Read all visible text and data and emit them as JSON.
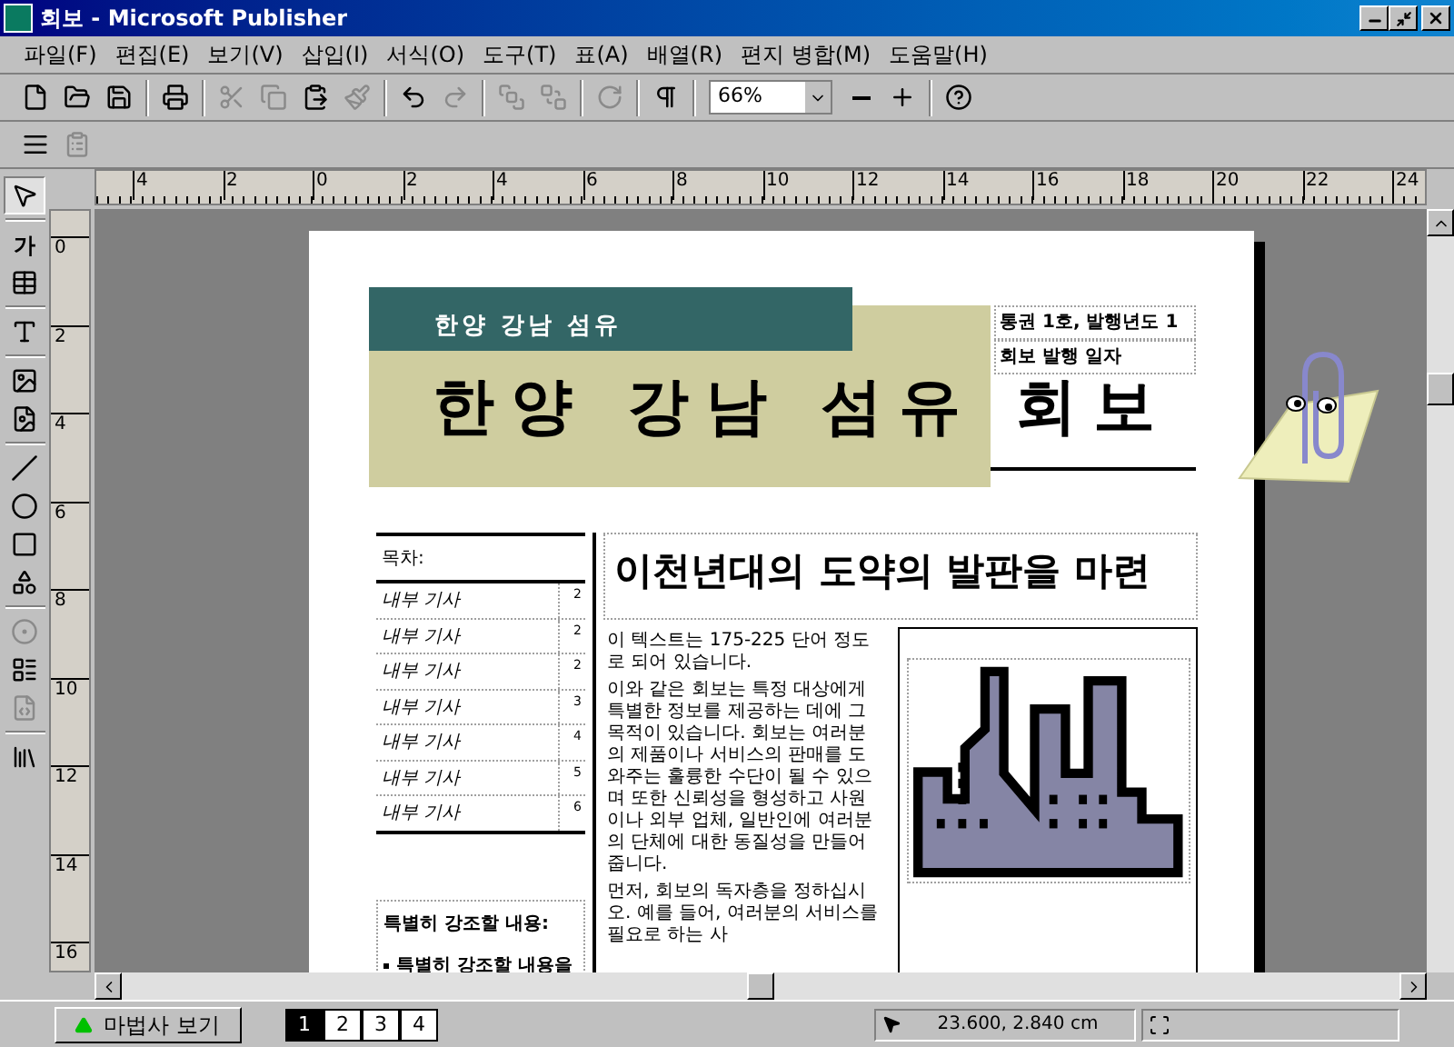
{
  "window": {
    "title": "회보 - Microsoft Publisher"
  },
  "menu": [
    "파일(F)",
    "편집(E)",
    "보기(V)",
    "삽입(I)",
    "서식(O)",
    "도구(T)",
    "표(A)",
    "배열(R)",
    "편지 병합(M)",
    "도움말(H)"
  ],
  "toolbar": [
    {
      "kind": "new",
      "disabled": false
    },
    {
      "kind": "open",
      "disabled": false
    },
    {
      "kind": "save",
      "disabled": false
    },
    {
      "kind": "separator"
    },
    {
      "kind": "print",
      "disabled": false
    },
    {
      "kind": "separator"
    },
    {
      "kind": "cut",
      "disabled": true
    },
    {
      "kind": "copy",
      "disabled": true
    },
    {
      "kind": "paste",
      "disabled": false
    },
    {
      "kind": "painter",
      "disabled": true
    },
    {
      "kind": "separator"
    },
    {
      "kind": "undo",
      "disabled": false
    },
    {
      "kind": "redo",
      "disabled": true
    },
    {
      "kind": "separator"
    },
    {
      "kind": "front",
      "disabled": true
    },
    {
      "kind": "back",
      "disabled": true
    },
    {
      "kind": "separator"
    },
    {
      "kind": "rotate",
      "disabled": true
    },
    {
      "kind": "separator"
    },
    {
      "kind": "pilcrow",
      "disabled": false
    },
    {
      "kind": "separator"
    },
    {
      "kind": "zoom",
      "value": "66%"
    },
    {
      "kind": "zoom-out",
      "disabled": false
    },
    {
      "kind": "zoom-in",
      "disabled": false
    },
    {
      "kind": "separator"
    },
    {
      "kind": "help",
      "disabled": false
    }
  ],
  "format_toolbar": [
    {
      "kind": "lines",
      "disabled": false
    },
    {
      "kind": "properties",
      "disabled": true
    }
  ],
  "tools": [
    {
      "kind": "pointer",
      "disabled": false,
      "selected": true
    },
    {
      "kind": "separator"
    },
    {
      "kind": "text",
      "label": "가",
      "disabled": false,
      "selected": false
    },
    {
      "kind": "table",
      "disabled": false,
      "selected": false
    },
    {
      "kind": "separator"
    },
    {
      "kind": "wordart",
      "disabled": false,
      "selected": false
    },
    {
      "kind": "separator"
    },
    {
      "kind": "picture",
      "disabled": false,
      "selected": false
    },
    {
      "kind": "clipart",
      "disabled": false,
      "selected": false
    },
    {
      "kind": "separator"
    },
    {
      "kind": "line",
      "disabled": false,
      "selected": false
    },
    {
      "kind": "oval",
      "disabled": false,
      "selected": false
    },
    {
      "kind": "rect",
      "disabled": false,
      "selected": false
    },
    {
      "kind": "shapes",
      "disabled": false,
      "selected": false
    },
    {
      "kind": "separator"
    },
    {
      "kind": "hotspot",
      "disabled": true,
      "selected": false
    },
    {
      "kind": "form",
      "disabled": false,
      "selected": false
    },
    {
      "kind": "html",
      "disabled": true,
      "selected": false
    },
    {
      "kind": "separator"
    },
    {
      "kind": "gallery",
      "disabled": false,
      "selected": false
    }
  ],
  "hruler": [
    "4",
    "2",
    "0",
    "2",
    "4",
    "6",
    "8",
    "10",
    "12",
    "14",
    "16",
    "18",
    "20",
    "22",
    "24"
  ],
  "vruler": [
    "0",
    "2",
    "4",
    "6",
    "8",
    "10",
    "12",
    "14",
    "16"
  ],
  "masthead": {
    "banner": "한양 강남 섬유",
    "title": "한양 강남 섬유 회보",
    "info": [
      "통권 1호, 발행년도 1",
      "회보 발행 일자"
    ]
  },
  "toc": {
    "heading": "목차:",
    "items": [
      {
        "title": "내부 기사",
        "page": "2"
      },
      {
        "title": "내부 기사",
        "page": "2"
      },
      {
        "title": "내부 기사",
        "page": "2"
      },
      {
        "title": "내부 기사",
        "page": "3"
      },
      {
        "title": "내부 기사",
        "page": "4"
      },
      {
        "title": "내부 기사",
        "page": "5"
      },
      {
        "title": "내부 기사",
        "page": "6"
      }
    ]
  },
  "callout": {
    "heading": "특별히 강조할 내용:",
    "bullets": [
      "특별히 강조할 내용을"
    ]
  },
  "article": {
    "headline": "이천년대의 도약의 발판을 마련",
    "paragraphs": [
      "이 텍스트는 175-225 단어 정도로 되어 있습니다.",
      "이와 같은 회보는 특정 대상에게 특별한 정보를 제공하는 데에 그 목적이 있습니다. 회보는 여러분의 제품이나 서비스의 판매를 도와주는 훌륭한 수단이 될 수 있으며 또한 신뢰성을 형성하고 사원이나 외부 업체, 일반인에 여러분의 단체에 대한 동질성을 만들어 줍니다.",
      "먼저, 회보의 독자층을 정하십시오. 예를 들어, 여러분의 서비스를 필요로 하는 사"
    ]
  },
  "status_bar": {
    "wizard_button": "마법사 보기",
    "pages": [
      {
        "label": "1",
        "selected": true
      },
      {
        "label": "2",
        "selected": false
      },
      {
        "label": "3",
        "selected": false
      },
      {
        "label": "4",
        "selected": false
      }
    ],
    "position": "23.600, 2.840 cm"
  }
}
